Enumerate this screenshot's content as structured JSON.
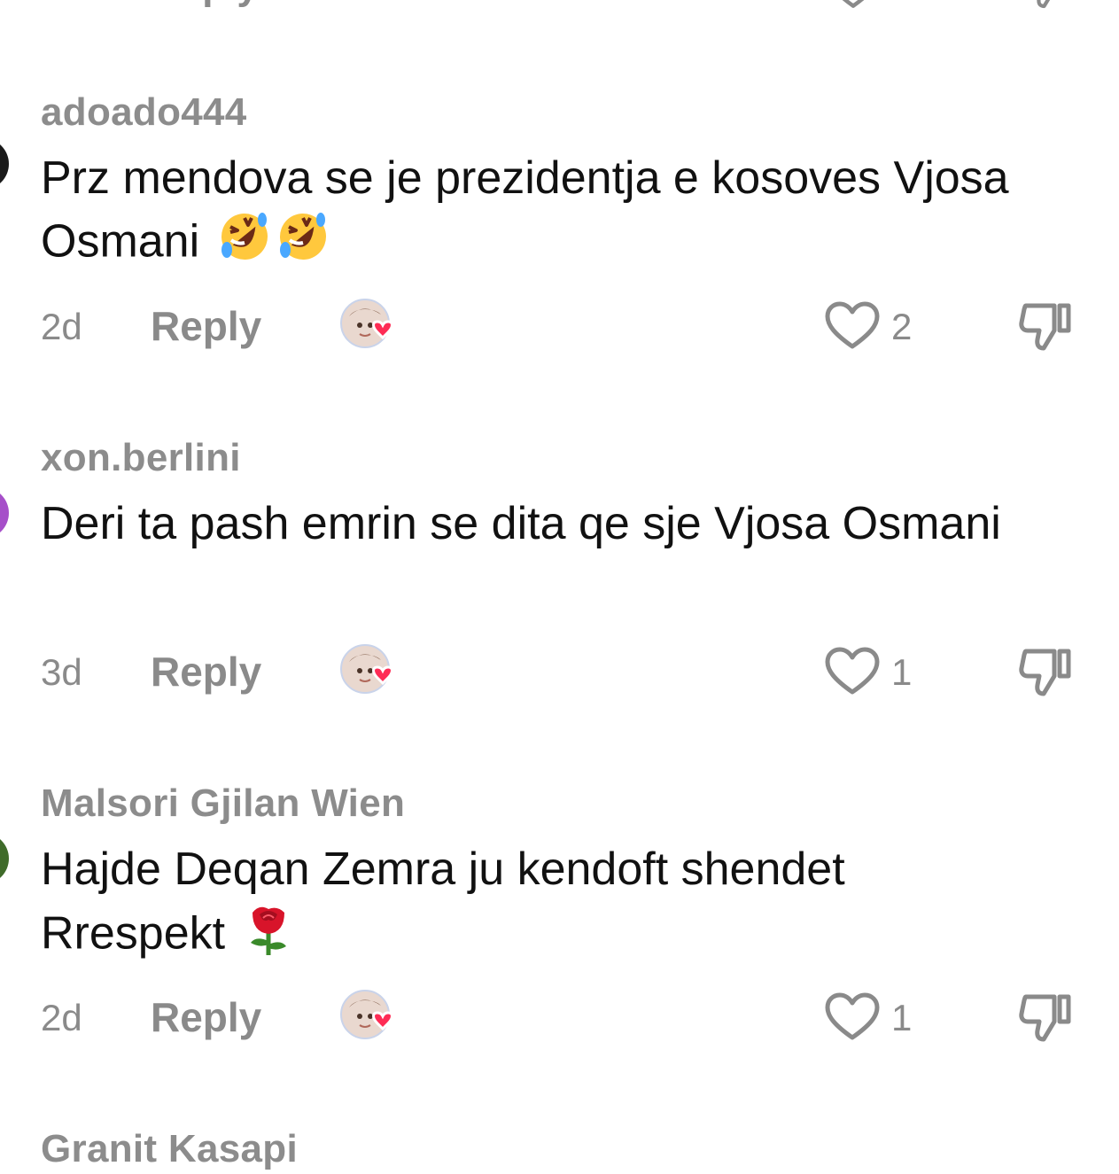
{
  "top_partial": {
    "reply_label": "Reply"
  },
  "comments": [
    {
      "username": "adoado444",
      "text": "Prz mendova se je prezidentja e kosoves Vjosa Osmani",
      "emoji": "rolling-on-floor-laughing x2",
      "time": "2d",
      "reply_label": "Reply",
      "likes": "2",
      "avatar_color": "#1a1a1a"
    },
    {
      "username": "xon.berlini",
      "text": "Deri ta pash emrin se dita qe sje Vjosa Osmani",
      "time": "3d",
      "reply_label": "Reply",
      "likes": "1",
      "avatar_color": "#a64fc9"
    },
    {
      "username": "Malsori Gjilan Wien",
      "text": "Hajde Deqan Zemra ju kendoft shendet Rrespekt",
      "emoji": "rose",
      "time": "2d",
      "reply_label": "Reply",
      "likes": "1",
      "avatar_color": "#3f6b2a"
    },
    {
      "username": "Granit Kasapi"
    }
  ],
  "colors": {
    "muted_text": "#8a8a8a",
    "body_text": "#111111",
    "heart_red": "#fe2c55",
    "background": "#ffffff"
  },
  "icons": [
    "heart-outline-icon",
    "dislike-icon",
    "creator-liked-avatar-icon",
    "laughing-emoji-icon",
    "rose-emoji-icon"
  ]
}
